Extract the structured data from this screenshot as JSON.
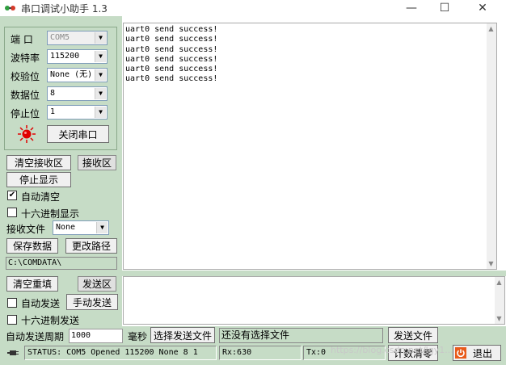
{
  "window": {
    "title": "串口调试小助手 1.3",
    "minimize_glyph": "—",
    "maximize_glyph": "☐",
    "close_glyph": "✕"
  },
  "serial_settings": {
    "port_label": "端  口",
    "port_value": "COM5",
    "baud_label": "波特率",
    "baud_value": "115200",
    "parity_label": "校验位",
    "parity_value": "None (无)",
    "databits_label": "数据位",
    "databits_value": "8",
    "stopbits_label": "停止位",
    "stopbits_value": "1",
    "port_toggle_label": "关闭串口",
    "port_status_color": "#e00000"
  },
  "receive": {
    "clear_label": "清空接收区",
    "area_label": "接收区",
    "stop_display_label": "停止显示",
    "auto_clear_label": "自动清空",
    "auto_clear_checked": "✔",
    "hex_display_label": "十六进制显示",
    "hex_display_checked": "",
    "file_label": "接收文件",
    "file_select_value": "None",
    "save_data_label": "保存数据",
    "change_path_label": "更改路径",
    "path_value": "C:\\COMDATA\\",
    "lines": [
      "uart0 send success!",
      "uart0 send success!",
      "uart0 send success!",
      "uart0 send success!",
      "uart0 send success!",
      "uart0 send success!"
    ]
  },
  "send": {
    "clear_resend_label": "清空重填",
    "area_label": "发送区",
    "auto_send_label": "自动发送",
    "auto_send_checked": "",
    "manual_send_label": "手动发送",
    "hex_send_label": "十六进制发送",
    "hex_send_checked": "",
    "period_label": "自动发送周期",
    "period_value": "1000",
    "period_unit": "毫秒",
    "select_file_label": "选择发送文件",
    "file_status": "还没有选择文件",
    "send_file_label": "发送文件",
    "reset_count_label": "计数清零",
    "exit_label": "退出"
  },
  "status": {
    "text": "STATUS: COM5 Opened 115200 None  8 1",
    "rx": "Rx:630",
    "tx": "Tx:0"
  },
  "watermark": "https://blog.csdn.net/lgy1..."
}
